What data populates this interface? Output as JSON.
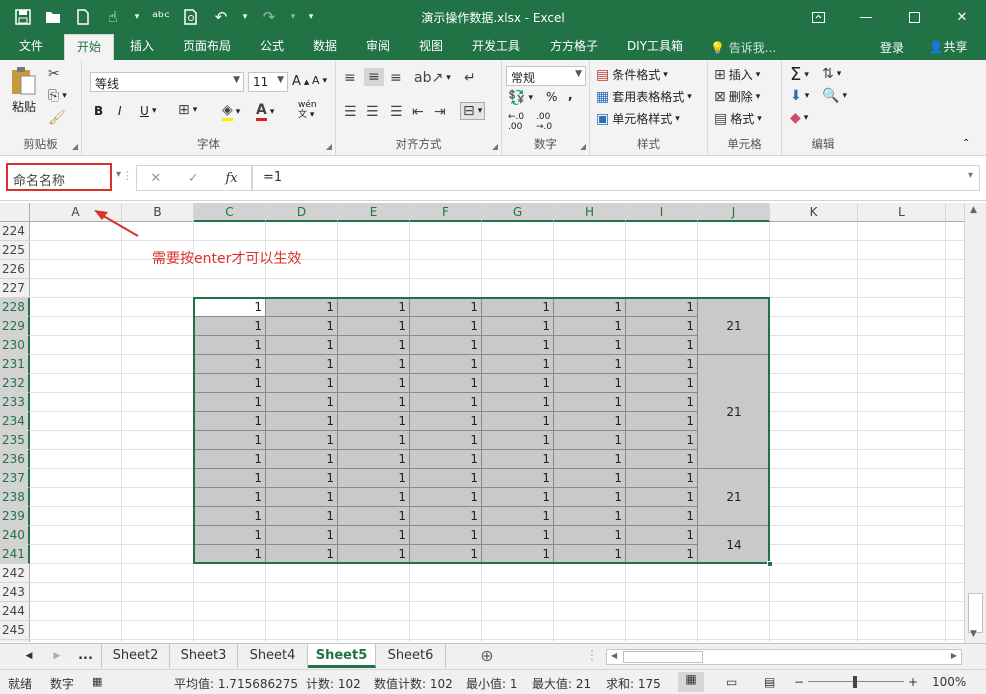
{
  "window": {
    "title": "演示操作数据.xlsx - Excel",
    "qat": [
      "save-icon",
      "open-icon",
      "new-icon",
      "touch-icon",
      "spell-icon",
      "preview-icon",
      "undo-icon",
      "redo-icon",
      "customize-icon"
    ],
    "controls": [
      "ribbon-display-icon",
      "minimize-icon",
      "maximize-icon",
      "close-icon"
    ]
  },
  "tabs": [
    "文件",
    "开始",
    "插入",
    "页面布局",
    "公式",
    "数据",
    "审阅",
    "视图",
    "开发工具",
    "方方格子",
    "DIY工具箱"
  ],
  "active_tab": "开始",
  "tellme": "告诉我...",
  "login": "登录",
  "share": "共享",
  "ribbon": {
    "clipboard": {
      "label": "剪贴板",
      "paste": "粘贴"
    },
    "font": {
      "label": "字体",
      "name": "等线",
      "size": "11",
      "bold": "B",
      "italic": "I",
      "underline": "U",
      "wen": "wén\n文"
    },
    "align": {
      "label": "对齐方式"
    },
    "number": {
      "label": "数字",
      "format": "常规",
      "percent": "%",
      "comma": ","
    },
    "styles": {
      "label": "样式",
      "cond": "条件格式",
      "table": "套用表格格式",
      "cell": "单元格样式"
    },
    "cells": {
      "label": "单元格",
      "insert": "插入",
      "delete": "删除",
      "format": "格式"
    },
    "editing": {
      "label": "编辑"
    }
  },
  "formula_bar": {
    "name_box": "命名名称",
    "formula": "=1",
    "fx": "fx"
  },
  "annotation": "需要按enter才可以生效",
  "columns": [
    "A",
    "B",
    "C",
    "D",
    "E",
    "F",
    "G",
    "H",
    "I",
    "J",
    "K",
    "L"
  ],
  "rows": [
    "224",
    "225",
    "226",
    "227",
    "228",
    "229",
    "230",
    "231",
    "232",
    "233",
    "234",
    "235",
    "236",
    "237",
    "238",
    "239",
    "240",
    "241",
    "242",
    "243",
    "244",
    "245"
  ],
  "cell_value": "1",
  "merged_values": [
    "21",
    "21",
    "21",
    "14"
  ],
  "sheet_tabs": [
    "...",
    "Sheet2",
    "Sheet3",
    "Sheet4",
    "Sheet5",
    "Sheet6"
  ],
  "active_sheet": "Sheet5",
  "status": {
    "mode": "就绪",
    "num": "数字",
    "avg": "平均值: 1.715686275",
    "count": "计数: 102",
    "numcount": "数值计数: 102",
    "min": "最小值: 1",
    "max": "最大值: 21",
    "sum": "求和: 175",
    "zoom": "100%"
  }
}
